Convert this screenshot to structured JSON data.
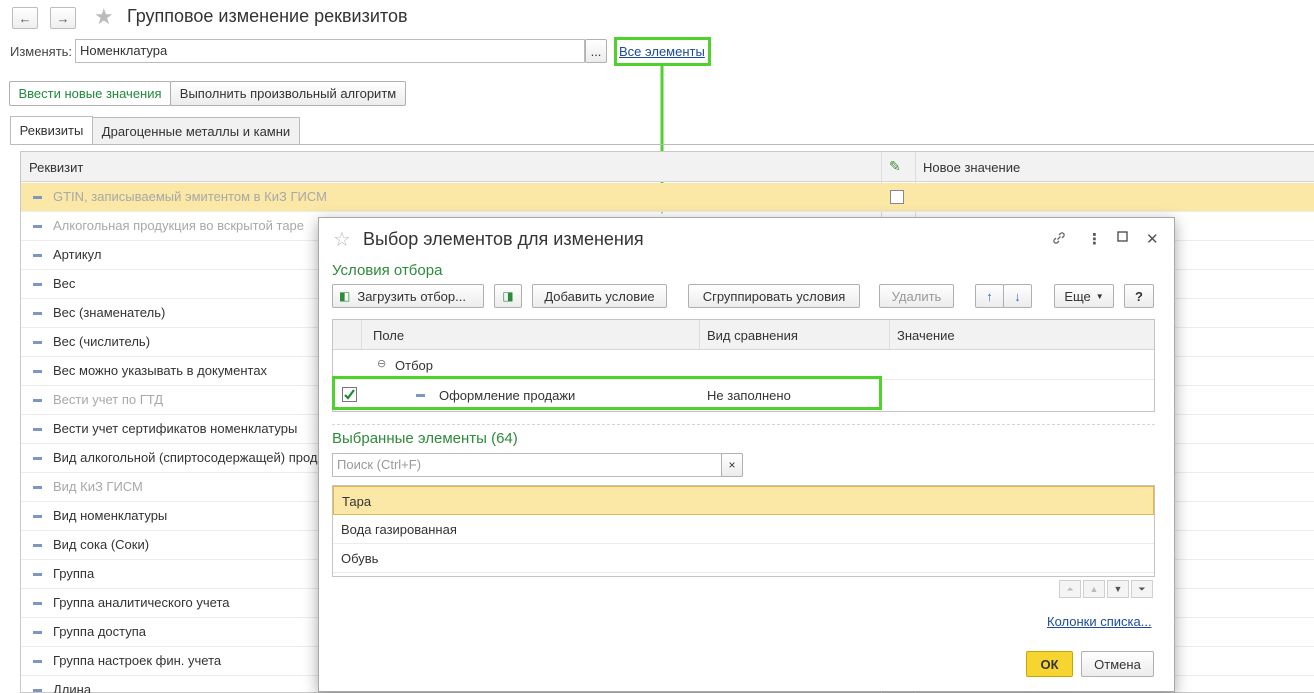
{
  "header": {
    "title": "Групповое изменение реквизитов",
    "back_icon": "←",
    "forward_icon": "→",
    "star_icon": "★"
  },
  "change": {
    "label": "Изменять:",
    "value": "Номенклатура",
    "select_button": "...",
    "all_elements_link": "Все элементы"
  },
  "mode_buttons": [
    "Ввести новые значения",
    "Выполнить произвольный алгоритм"
  ],
  "tabs": [
    "Реквизиты",
    "Драгоценные металлы и камни"
  ],
  "table": {
    "columns": [
      "Реквизит",
      "✎",
      "Новое значение"
    ],
    "rows": [
      {
        "label": "GTIN, записываемый эмитентом в КиЗ ГИСМ",
        "gray": true,
        "selected": true
      },
      {
        "label": "Алкогольная продукция во вскрытой таре",
        "gray": true
      },
      {
        "label": "Артикул",
        "gray": false
      },
      {
        "label": "Вес",
        "gray": false
      },
      {
        "label": "Вес (знаменатель)",
        "gray": false
      },
      {
        "label": "Вес (числитель)",
        "gray": false
      },
      {
        "label": "Вес можно указывать в документах",
        "gray": false
      },
      {
        "label": "Вести учет по ГТД",
        "gray": true
      },
      {
        "label": "Вести учет сертификатов номенклатуры",
        "gray": false
      },
      {
        "label": "Вид алкогольной (спиртосодержащей) прод",
        "gray": false
      },
      {
        "label": "Вид КиЗ ГИСМ",
        "gray": true
      },
      {
        "label": "Вид номенклатуры",
        "gray": false
      },
      {
        "label": "Вид сока (Соки)",
        "gray": false
      },
      {
        "label": "Группа",
        "gray": false
      },
      {
        "label": "Группа аналитического учета",
        "gray": false
      },
      {
        "label": "Группа доступа",
        "gray": false
      },
      {
        "label": "Группа настроек фин. учета",
        "gray": false
      },
      {
        "label": "Длина",
        "gray": false
      }
    ]
  },
  "dialog": {
    "title": "Выбор элементов для изменения",
    "icons": {
      "link": "🔗",
      "more": "⋮",
      "maximize": "☐",
      "close": "✕"
    },
    "filter_section": "Условия отбора",
    "toolbar": {
      "load": "Загрузить отбор...",
      "add": "Добавить условие",
      "group": "Сгруппировать условия",
      "delete": "Удалить",
      "up": "↑",
      "down": "↓",
      "more": "Еще",
      "help": "?"
    },
    "filter_columns": [
      "Поле",
      "Вид сравнения",
      "Значение"
    ],
    "filter_group": "Отбор",
    "filter_row": {
      "field": "Оформление продажи",
      "comparison": "Не заполнено",
      "value": ""
    },
    "selected_section": "Выбранные элементы (64)",
    "search_placeholder": "Поиск (Ctrl+F)",
    "search_clear": "×",
    "items": [
      "Тара",
      "Вода газированная",
      "Обувь"
    ],
    "columns_link": "Колонки списка...",
    "ok": "ОК",
    "cancel": "Отмена"
  },
  "colors": {
    "accent_green": "#2e8b3a",
    "highlight": "#4fd22c",
    "selection": "#fbe7a6",
    "ok_button": "#f7d531"
  }
}
